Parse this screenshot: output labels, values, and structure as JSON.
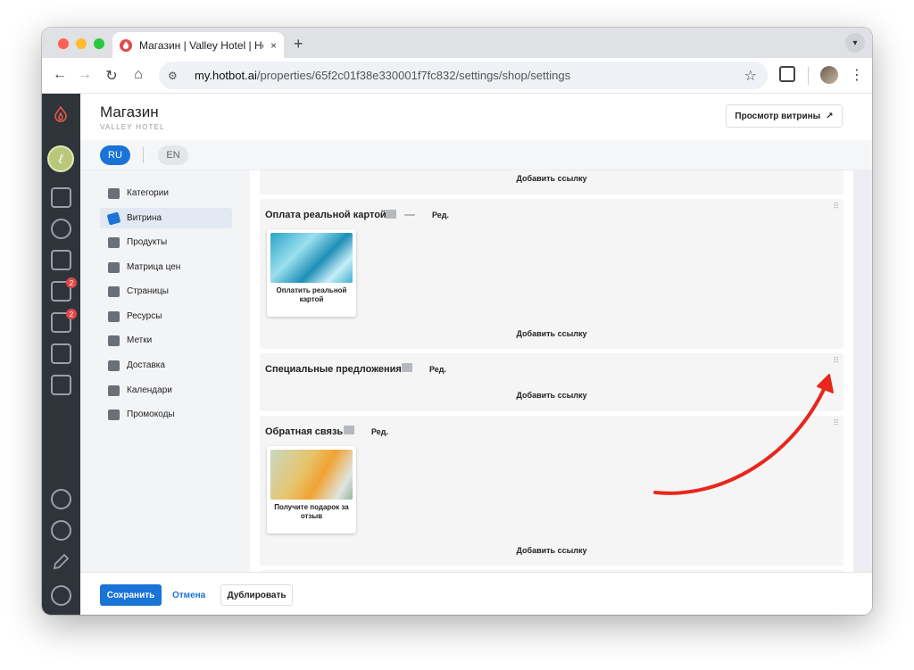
{
  "browser": {
    "tab_title": "Магазин | Valley Hotel | Hotbot",
    "tab_close": "×",
    "new_tab": "+",
    "url_domain": "my.hotbot.ai",
    "url_path": "/properties/65f2c01f38e330001f7fc832/settings/shop/settings"
  },
  "header": {
    "title": "Магазин",
    "subtitle": "VALLEY HOTEL",
    "preview_button": "Просмотр витрины",
    "preview_icon": "↗"
  },
  "languages": {
    "active": "RU",
    "other": "EN"
  },
  "rail": {
    "badges": [
      "2",
      "2"
    ]
  },
  "sidebar": {
    "items": [
      {
        "label": "Категории",
        "icon": "store-icon"
      },
      {
        "label": "Витрина",
        "icon": "tag-icon"
      },
      {
        "label": "Продукты",
        "icon": "grid-icon"
      },
      {
        "label": "Матрица цен",
        "icon": "table-icon"
      },
      {
        "label": "Страницы",
        "icon": "page-icon"
      },
      {
        "label": "Ресурсы",
        "icon": "resource-icon"
      },
      {
        "label": "Метки",
        "icon": "label-icon"
      },
      {
        "label": "Доставка",
        "icon": "truck-icon"
      },
      {
        "label": "Календари",
        "icon": "calendar-icon"
      },
      {
        "label": "Промокоды",
        "icon": "promo-icon"
      }
    ],
    "active_index": 1
  },
  "content": {
    "top_add_link": "Добавить ссылку",
    "blocks": [
      {
        "title": "Оплата реальной картой",
        "edit": "Ред.",
        "card_label": "Оплатить реальной картой",
        "add_link": "Добавить ссылку"
      },
      {
        "title": "Специальные предложения",
        "edit": "Ред.",
        "add_link": "Добавить ссылку"
      },
      {
        "title": "Обратная связь",
        "edit": "Ред.",
        "card_label": "Получите подарок за отзыв",
        "add_link": "Добавить ссылку"
      }
    ]
  },
  "footer": {
    "save": "Сохранить",
    "cancel": "Отмена",
    "duplicate": "Дублировать"
  },
  "colors": {
    "accent": "#1a73d6",
    "rail_bg": "#2f343b",
    "arrow": "#e8261b",
    "badge": "#e0474a"
  }
}
